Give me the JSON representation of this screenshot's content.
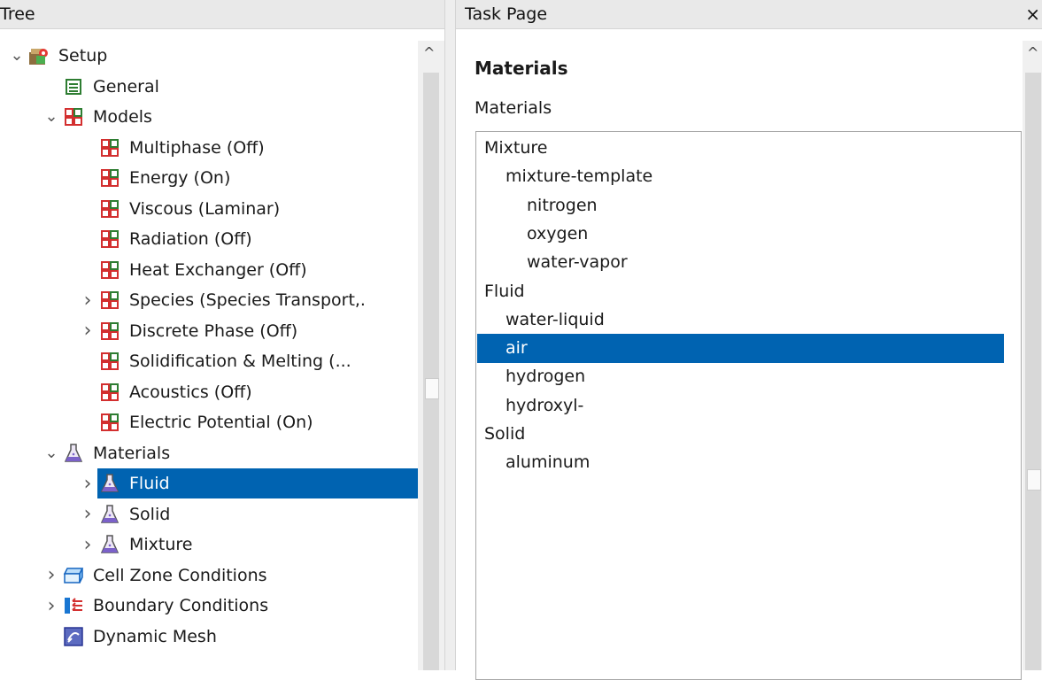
{
  "tree_header": "Tree",
  "task_header": "Task Page",
  "close_glyph": "×",
  "tree": [
    {
      "label": "Setup",
      "indent": 0,
      "chevron": "expanded",
      "icon": "setup-icon"
    },
    {
      "label": "General",
      "indent": 1,
      "chevron": "none",
      "icon": "general-icon"
    },
    {
      "label": "Models",
      "indent": 1,
      "chevron": "expanded",
      "icon": "models-icon"
    },
    {
      "label": "Multiphase (Off)",
      "indent": 2,
      "chevron": "none",
      "icon": "models-icon"
    },
    {
      "label": "Energy (On)",
      "indent": 2,
      "chevron": "none",
      "icon": "models-icon"
    },
    {
      "label": "Viscous (Laminar)",
      "indent": 2,
      "chevron": "none",
      "icon": "models-icon"
    },
    {
      "label": "Radiation (Off)",
      "indent": 2,
      "chevron": "none",
      "icon": "models-icon"
    },
    {
      "label": "Heat Exchanger (Off)",
      "indent": 2,
      "chevron": "none",
      "icon": "models-icon"
    },
    {
      "label": "Species (Species Transport,.",
      "indent": 2,
      "chevron": "collapsed",
      "icon": "models-icon"
    },
    {
      "label": "Discrete Phase (Off)",
      "indent": 2,
      "chevron": "collapsed",
      "icon": "models-icon"
    },
    {
      "label": "Solidification & Melting (...",
      "indent": 2,
      "chevron": "none",
      "icon": "models-icon"
    },
    {
      "label": "Acoustics (Off)",
      "indent": 2,
      "chevron": "none",
      "icon": "models-icon"
    },
    {
      "label": "Electric Potential (On)",
      "indent": 2,
      "chevron": "none",
      "icon": "models-icon"
    },
    {
      "label": "Materials",
      "indent": 1,
      "chevron": "expanded",
      "icon": "flask-icon"
    },
    {
      "label": "Fluid",
      "indent": 2,
      "chevron": "collapsed",
      "icon": "flask-icon",
      "selected": true
    },
    {
      "label": "Solid",
      "indent": 2,
      "chevron": "collapsed",
      "icon": "flask-icon"
    },
    {
      "label": "Mixture",
      "indent": 2,
      "chevron": "collapsed",
      "icon": "flask-icon"
    },
    {
      "label": "Cell Zone Conditions",
      "indent": 1,
      "chevron": "collapsed",
      "icon": "cell-zone-icon"
    },
    {
      "label": "Boundary Conditions",
      "indent": 1,
      "chevron": "collapsed",
      "icon": "boundary-icon"
    },
    {
      "label": "Dynamic Mesh",
      "indent": 1,
      "chevron": "none",
      "icon": "dynamic-mesh-icon"
    }
  ],
  "task": {
    "title": "Materials",
    "list_label": "Materials",
    "materials": [
      {
        "label": "Mixture",
        "level": 0
      },
      {
        "label": "mixture-template",
        "level": 1
      },
      {
        "label": "nitrogen",
        "level": 2
      },
      {
        "label": "oxygen",
        "level": 2
      },
      {
        "label": "water-vapor",
        "level": 2
      },
      {
        "label": "Fluid",
        "level": 0
      },
      {
        "label": "water-liquid",
        "level": 1
      },
      {
        "label": "air",
        "level": 1,
        "selected": true
      },
      {
        "label": "hydrogen",
        "level": 1
      },
      {
        "label": "hydroxyl-",
        "level": 1
      },
      {
        "label": "Solid",
        "level": 0
      },
      {
        "label": "aluminum",
        "level": 1
      }
    ]
  },
  "colors": {
    "selection": "#0063b1",
    "models_red": "#d32f2f",
    "models_green": "#2e7d32",
    "flask_purple": "#7b61c9"
  }
}
